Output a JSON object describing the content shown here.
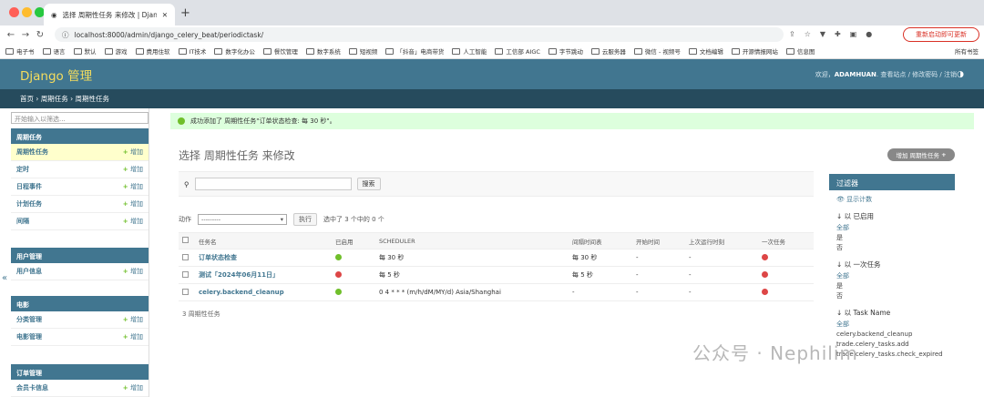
{
  "browser": {
    "tab_title": "选择 周期性任务 来修改 | Djang...",
    "url": "localhost:8000/admin/django_celery_beat/periodictask/",
    "restart_label": "重新启动即可更新",
    "bookmarks": [
      "电子书",
      "语言",
      "默认",
      "游戏",
      "费用住软",
      "IT技术",
      "数字化办公",
      "餐饮管理",
      "数字系统",
      "短视频",
      "「抖音」电商带货",
      "人工智能",
      "工信部 AIGC",
      "字节跳动",
      "云服务器",
      "微信 - 视频号",
      "文档编辑",
      "开源情报网站",
      "信息图"
    ],
    "bookmarks_right": "所有书签",
    "colors": {
      "close": "#ff5f57",
      "min": "#febc2e",
      "max": "#28c840"
    }
  },
  "header": {
    "brand": "Django 管理",
    "welcome": "欢迎，",
    "username": "ADAMHUAN",
    "links": "查看站点 / 修改密码 / 注销"
  },
  "breadcrumb": "首页 › 周期任务 › 周期性任务",
  "sidebar": {
    "filter_placeholder": "开始输入以筛选...",
    "modules": [
      {
        "title": "周期任务",
        "items": [
          "周期性任务",
          "定时",
          "日程事件",
          "计划任务",
          "间隔"
        ]
      },
      {
        "title": "用户管理",
        "items": [
          "用户信息"
        ]
      },
      {
        "title": "电影",
        "items": [
          "分类管理",
          "电影管理"
        ]
      },
      {
        "title": "订单管理",
        "items": [
          "会员卡信息"
        ]
      }
    ],
    "add_label": "增加"
  },
  "message": "成功添加了 周期性任务\"订单状态检查: 每 30 秒\"。",
  "page_title": "选择 周期性任务 来修改",
  "add_button": "增加 周期性任务",
  "search_button": "搜索",
  "actions": {
    "label": "动作",
    "select_value": "---------",
    "go": "执行",
    "selected": "选中了 3 个中的 0 个"
  },
  "table": {
    "headers": [
      "任务名",
      "已启用",
      "SCHEDULER",
      "间隔时间表",
      "开始时间",
      "上次运行时刻",
      "一次任务"
    ],
    "rows": [
      {
        "name": "订单状态检查",
        "enabled": true,
        "scheduler": "每 30 秒",
        "interval": "每 30 秒",
        "start": "-",
        "last": "-",
        "oneoff": false
      },
      {
        "name": "测试「2024年06月11日」",
        "enabled": false,
        "scheduler": "每 5 秒",
        "interval": "每 5 秒",
        "start": "-",
        "last": "-",
        "oneoff": false
      },
      {
        "name": "celery.backend_cleanup",
        "enabled": true,
        "scheduler": "0 4 * * * (m/h/dM/MY/d) Asia/Shanghai",
        "interval": "-",
        "start": "-",
        "last": "-",
        "oneoff": false
      }
    ]
  },
  "result_count": "3 周期性任务",
  "filter": {
    "title": "过滤器",
    "show_counts": "显示计数",
    "sections": [
      {
        "title": "以 已启用",
        "options": [
          "全部",
          "是",
          "否"
        ]
      },
      {
        "title": "以 一次任务",
        "options": [
          "全部",
          "是",
          "否"
        ]
      },
      {
        "title": "以 Task Name",
        "options": [
          "全部",
          "celery.backend_cleanup",
          "trade.celery_tasks.add",
          "trade.celery_tasks.check_expired"
        ]
      }
    ]
  },
  "watermark": "公众号 · Nephilim"
}
